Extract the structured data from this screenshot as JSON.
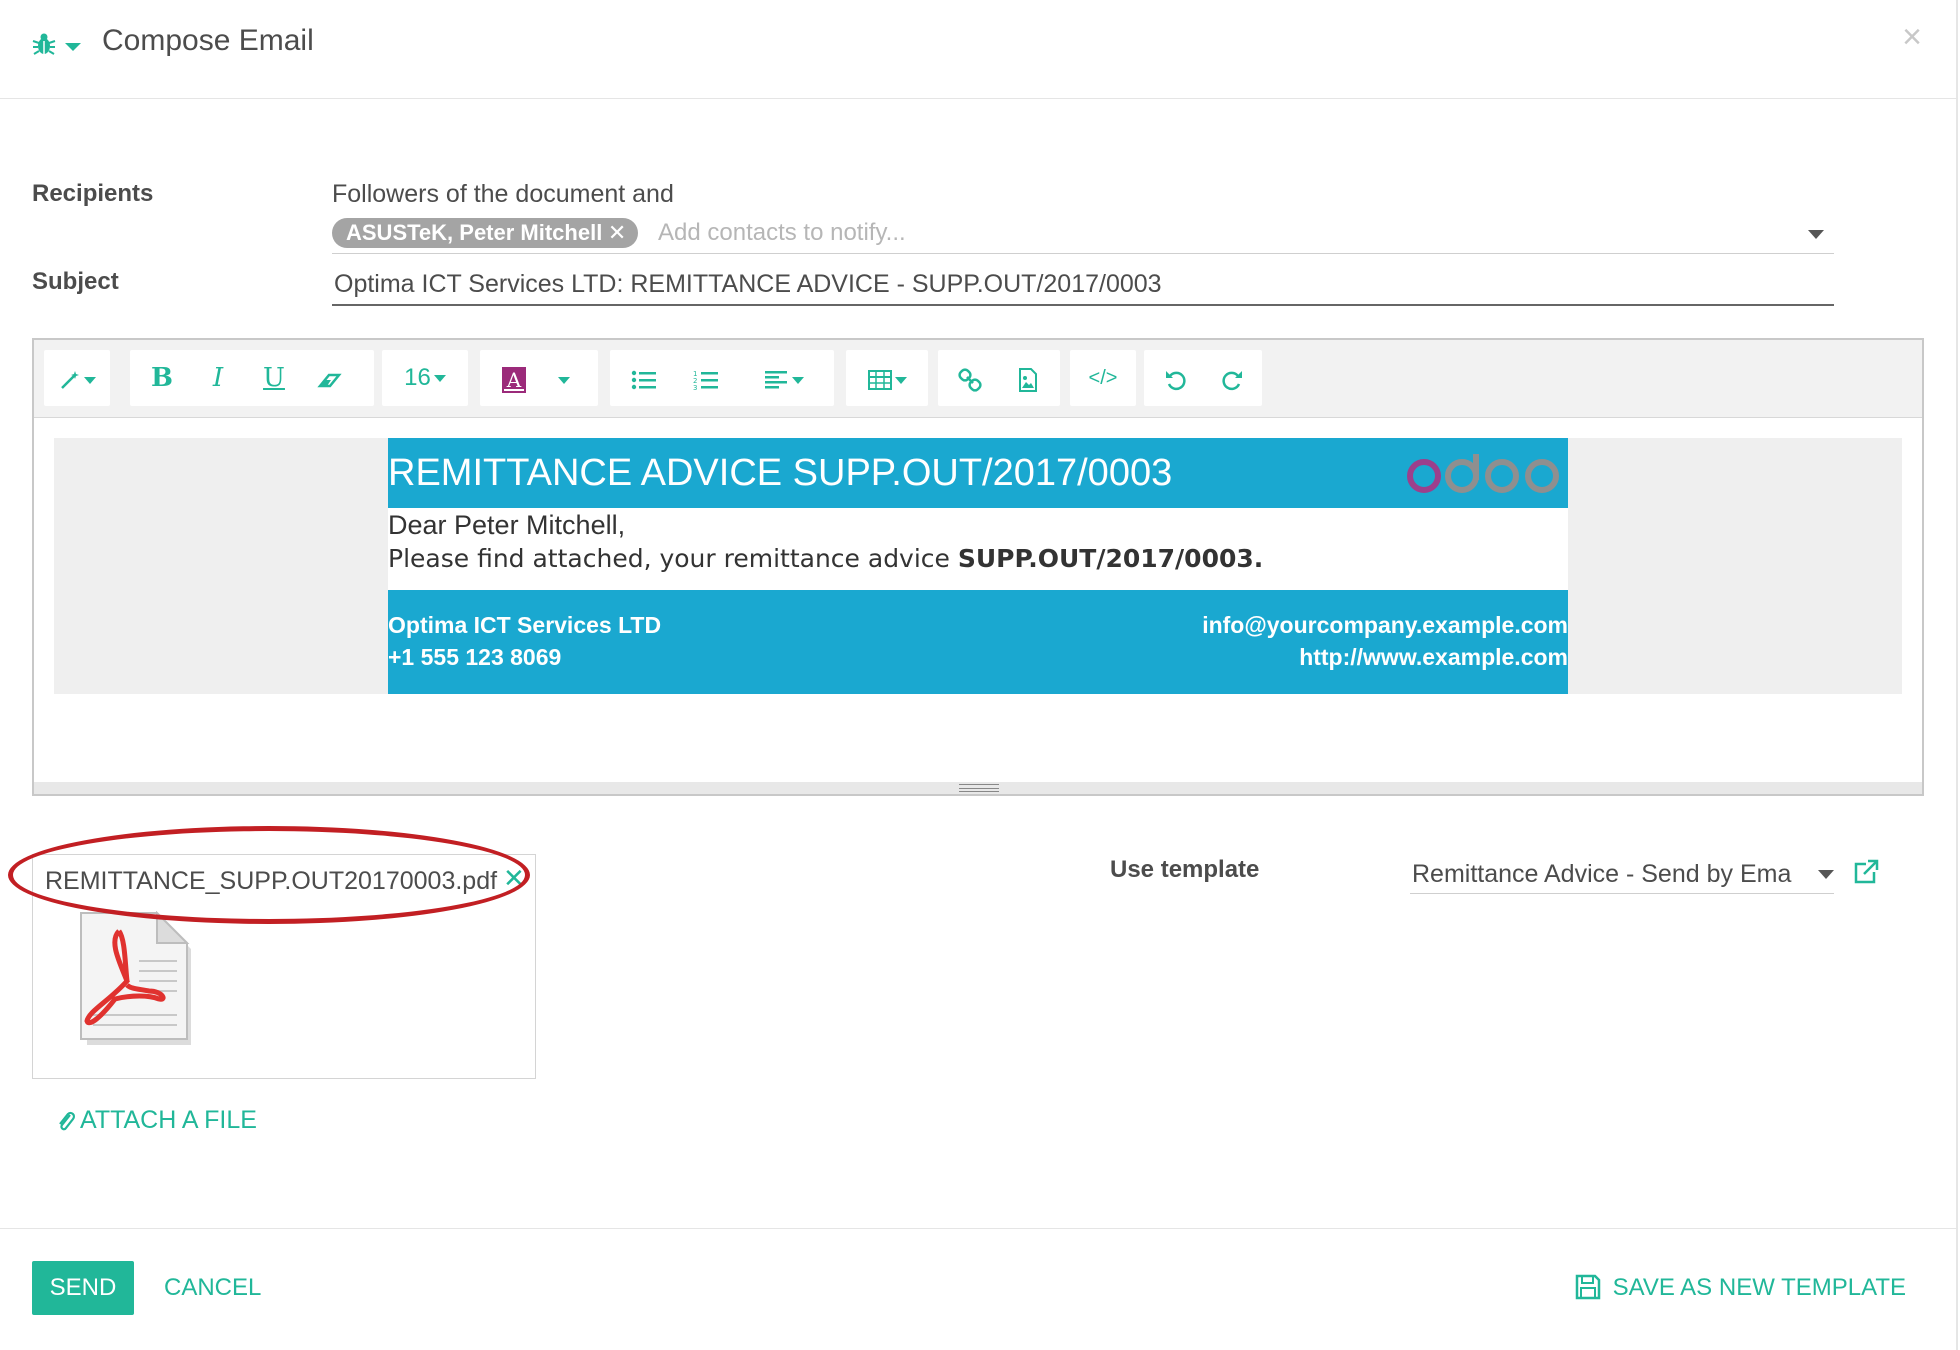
{
  "dialog": {
    "title": "Compose Email",
    "close_label": "×"
  },
  "form": {
    "recipients_label": "Recipients",
    "followers_text": "Followers of the document and",
    "recipient_tag": "ASUSTeK, Peter Mitchell",
    "recipients_placeholder": "Add contacts to notify...",
    "subject_label": "Subject",
    "subject_value": "Optima ICT Services LTD: REMITTANCE ADVICE -  SUPP.OUT/2017/0003"
  },
  "toolbar": {
    "font_size": "16",
    "icons": [
      "magic-wand-icon",
      "bold-icon",
      "italic-icon",
      "underline-icon",
      "eraser-icon",
      "font-size-dropdown",
      "text-color-icon",
      "unordered-list-icon",
      "ordered-list-icon",
      "align-icon",
      "table-icon",
      "link-icon",
      "image-icon",
      "code-view-icon",
      "undo-icon",
      "redo-icon"
    ]
  },
  "email_body": {
    "banner_title": "REMITTANCE ADVICE SUPP.OUT/2017/0003",
    "greeting": "Dear Peter Mitchell,",
    "message_prefix": "Please find attached, your remittance advice ",
    "message_ref": "SUPP.OUT/2017/0003.",
    "company": "Optima ICT Services LTD",
    "phone": "+1 555 123 8069",
    "email": "info@yourcompany.example.com",
    "website": "http://www.example.com",
    "logo": "odoo"
  },
  "attachments": {
    "file_name": "REMITTANCE_SUPP.OUT20170003.pdf",
    "attach_label": "ATTACH A FILE"
  },
  "template": {
    "label": "Use template",
    "value": "Remittance Advice - Send by Ema"
  },
  "footer": {
    "send_label": "SEND",
    "cancel_label": "CANCEL",
    "save_template_label": "SAVE AS NEW TEMPLATE"
  },
  "colors": {
    "accent": "#21b799",
    "banner": "#1aa8d0",
    "highlight_ellipse": "#c21f23"
  }
}
